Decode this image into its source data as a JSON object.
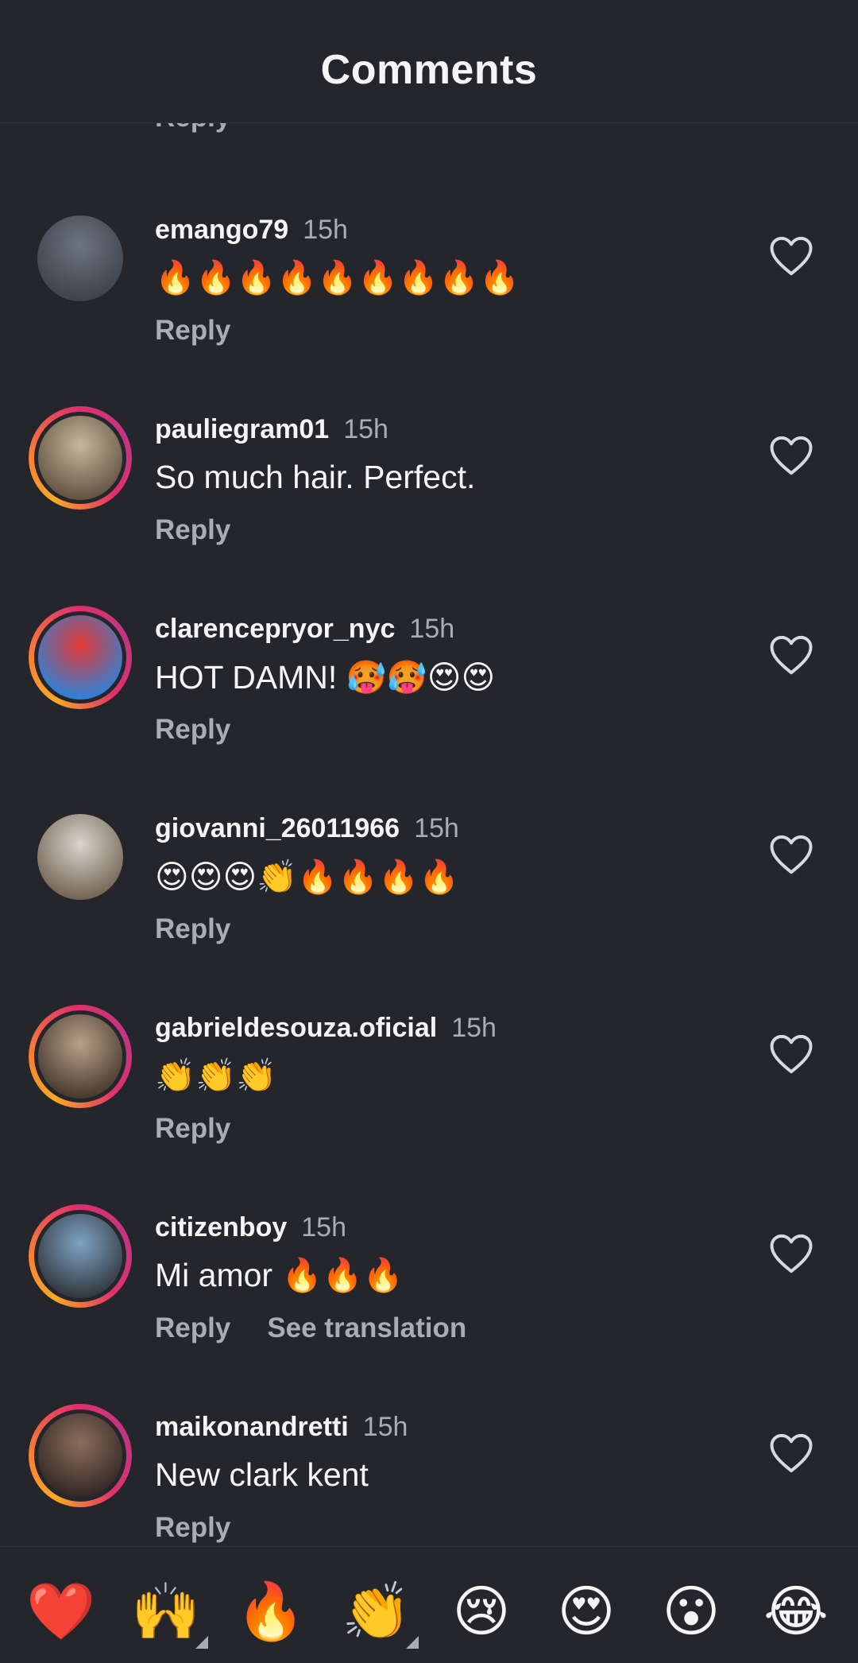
{
  "header": {
    "title": "Comments"
  },
  "previous_comment": {
    "reply_label": "Reply"
  },
  "comments": [
    {
      "username": "emango79",
      "time": "15h",
      "text": "🔥🔥🔥🔥🔥🔥🔥🔥🔥",
      "reply_label": "Reply",
      "has_story_ring": false,
      "avatar_colors": [
        "#6c7480",
        "#3a3f47"
      ]
    },
    {
      "username": "pauliegram01",
      "time": "15h",
      "text": "So much hair. Perfect.",
      "reply_label": "Reply",
      "has_story_ring": true,
      "avatar_colors": [
        "#c7b79c",
        "#5a4a3a"
      ]
    },
    {
      "username": "clarencepryor_nyc",
      "time": "15h",
      "text": "HOT DAMN! 🥵🥵😍😍",
      "reply_label": "Reply",
      "has_story_ring": true,
      "avatar_colors": [
        "#e53935",
        "#1e88e5"
      ]
    },
    {
      "username": "giovanni_26011966",
      "time": "15h",
      "text": "😍😍😍👏🔥🔥🔥🔥",
      "reply_label": "Reply",
      "has_story_ring": false,
      "avatar_colors": [
        "#d9d4cc",
        "#6b5b4b"
      ]
    },
    {
      "username": "gabrieldesouza.oficial",
      "time": "15h",
      "text": "👏👏👏",
      "reply_label": "Reply",
      "has_story_ring": true,
      "avatar_colors": [
        "#b9a189",
        "#3e3128"
      ]
    },
    {
      "username": "citizenboy",
      "time": "15h",
      "text": "Mi amor 🔥🔥🔥",
      "reply_label": "Reply",
      "see_translation_label": "See translation",
      "has_story_ring": true,
      "avatar_colors": [
        "#7ea3c4",
        "#2c2f33"
      ]
    },
    {
      "username": "maikonandretti",
      "time": "15h",
      "text": "New clark kent",
      "reply_label": "Reply",
      "has_story_ring": true,
      "avatar_colors": [
        "#8c6e5c",
        "#2b2220"
      ]
    }
  ],
  "quick_reactions": [
    {
      "emoji": "❤️",
      "has_variants": false
    },
    {
      "emoji": "🙌",
      "has_variants": true
    },
    {
      "emoji": "🔥",
      "has_variants": false
    },
    {
      "emoji": "👏",
      "has_variants": true
    },
    {
      "emoji": "😢",
      "has_variants": false
    },
    {
      "emoji": "😍",
      "has_variants": false
    },
    {
      "emoji": "😮",
      "has_variants": false
    },
    {
      "emoji": "😂",
      "has_variants": false
    }
  ],
  "colors": {
    "background": "#24262b",
    "primary_text": "#f5f5f5",
    "secondary_text": "#a8acb5",
    "heart_outline": "#d7d9de"
  },
  "icons": {
    "like": "heart-outline-icon"
  }
}
